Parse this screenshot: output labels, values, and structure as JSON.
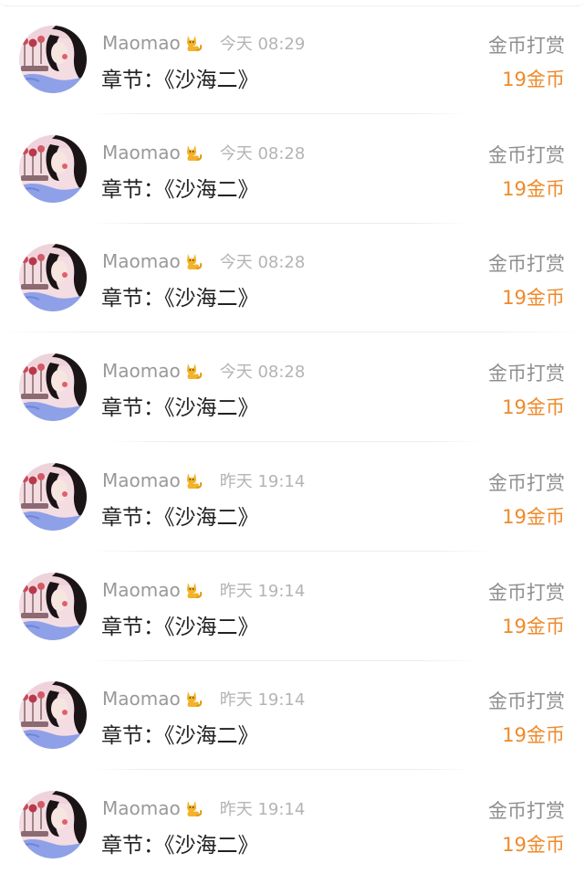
{
  "rewards": [
    {
      "user": "Maomao",
      "time": "今天 08:29",
      "chapter": "章节：《沙海二》",
      "reward_type": "金币打赏",
      "amount": "19金币"
    },
    {
      "user": "Maomao",
      "time": "今天 08:28",
      "chapter": "章节：《沙海二》",
      "reward_type": "金币打赏",
      "amount": "19金币"
    },
    {
      "user": "Maomao",
      "time": "今天 08:28",
      "chapter": "章节：《沙海二》",
      "reward_type": "金币打赏",
      "amount": "19金币"
    },
    {
      "user": "Maomao",
      "time": "今天 08:28",
      "chapter": "章节：《沙海二》",
      "reward_type": "金币打赏",
      "amount": "19金币"
    },
    {
      "user": "Maomao",
      "time": "昨天 19:14",
      "chapter": "章节：《沙海二》",
      "reward_type": "金币打赏",
      "amount": "19金币"
    },
    {
      "user": "Maomao",
      "time": "昨天 19:14",
      "chapter": "章节：《沙海二》",
      "reward_type": "金币打赏",
      "amount": "19金币"
    },
    {
      "user": "Maomao",
      "time": "昨天 19:14",
      "chapter": "章节：《沙海二》",
      "reward_type": "金币打赏",
      "amount": "19金币"
    },
    {
      "user": "Maomao",
      "time": "昨天 19:14",
      "chapter": "章节：《沙海二》",
      "reward_type": "金币打赏",
      "amount": "19金币"
    }
  ],
  "icons": {
    "user_badge": "cat-icon",
    "avatar": "avatar-illustration"
  },
  "colors": {
    "reward_amount": "#ee8a2a",
    "username": "#999999",
    "timestamp": "#b4b4b4",
    "chapter_text": "#222222"
  }
}
